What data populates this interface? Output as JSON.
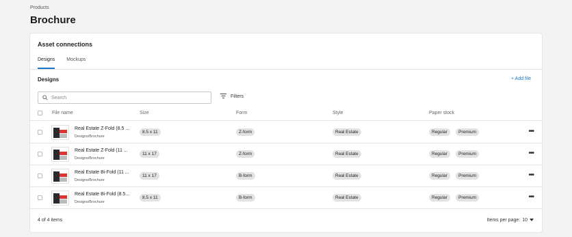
{
  "breadcrumb": "Products",
  "page_title": "Brochure",
  "card": {
    "title": "Asset connections",
    "tabs": [
      {
        "label": "Designs",
        "active": true
      },
      {
        "label": "Mockups",
        "active": false
      }
    ],
    "section_title": "Designs",
    "add_file_label": "+ Add file",
    "search": {
      "placeholder": "Search",
      "value": ""
    },
    "filters_label": "Filters",
    "columns": {
      "file_name": "File name",
      "size": "Size",
      "form": "Form",
      "style": "Style",
      "paper_stock": "Paper stock"
    },
    "rows": [
      {
        "name": "Real Estate Z-Fold (8.5 ...",
        "path": "Designs/Brochure",
        "size": "8.5 x 11",
        "form": "Z-form",
        "style": "Real Estate",
        "paper": [
          "Regular",
          "Premium"
        ],
        "thumb_icon": "brochure-thumbnail-icon"
      },
      {
        "name": "Real Estate Z-Fold (11 ...",
        "path": "Designs/Brochure",
        "size": "11 x 17",
        "form": "Z-form",
        "style": "Real Estate",
        "paper": [
          "Regular",
          "Premium"
        ],
        "thumb_icon": "brochure-thumbnail-icon"
      },
      {
        "name": "Real Estate Bi-Fold (11 ...",
        "path": "Designs/Brochure",
        "size": "11 x 17",
        "form": "B-form",
        "style": "Real Estate",
        "paper": [
          "Regular",
          "Premium"
        ],
        "thumb_icon": "brochure-thumbnail-icon"
      },
      {
        "name": "Real Estate Bi-Fold (8.5...",
        "path": "Designs/Brochure",
        "size": "8.5 x 11",
        "form": "B-form",
        "style": "Real Estate",
        "paper": [
          "Regular",
          "Premium"
        ],
        "thumb_icon": "brochure-thumbnail-icon"
      }
    ],
    "row_menu_glyph": "•••",
    "footer": {
      "count_label": "4 of 4 items",
      "items_per_page_label": "Items per page:",
      "items_per_page_value": "10"
    }
  },
  "colors": {
    "accent": "#1a73c8",
    "background": "#f3f3f3",
    "pill": "#e2e2e2"
  }
}
